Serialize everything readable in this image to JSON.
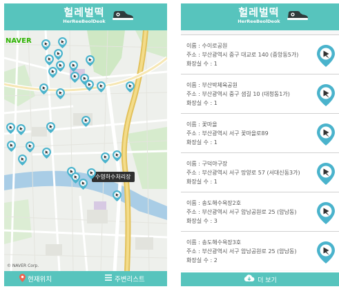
{
  "app": {
    "title": "헐레벌떡",
    "subtitle": "HerReeBeolDeok"
  },
  "map": {
    "brand": "NAVER",
    "copyright": "© NAVER Corp.",
    "tooltip": "수영하수처리장"
  },
  "bottom_bar": {
    "location_label": "현재위치",
    "list_label": "주변리스트"
  },
  "list": {
    "items": [
      {
        "name": "이름 : 수이로공원",
        "address": "주소 : 부산광역시 중구 대교로 140 (중앙동5가)",
        "toilets": "화장실 수 : 1"
      },
      {
        "name": "이름 : 부산박체육공원",
        "address": "주소 : 부산광역시 중구 샘길 10 (대청동1가)",
        "toilets": "화장실 수 : 1"
      },
      {
        "name": "이름 : 꽃마을",
        "address": "주소 : 부산광역시 서구 꽃마을로89",
        "toilets": "화장실 수 : 1"
      },
      {
        "name": "이름 : 구덕야구장",
        "address": "주소 : 부산광역시 서구 망양로 57 (서대신동3가)",
        "toilets": "화장실 수 : 1"
      },
      {
        "name": "이름 : 송도해수욕장2호",
        "address": "주소 : 부산광역시 서구 암남공원로 25 (암남동)",
        "toilets": "화장실 수 : 3"
      },
      {
        "name": "이름 : 송도해수욕장3호",
        "address": "주소 : 부산광역시 서구 암남공원로 25 (암남동)",
        "toilets": "화장실 수 : 2"
      }
    ],
    "more_label": "더 보기"
  },
  "icons": {
    "logo": "sneaker-icon",
    "marker": "map-marker-icon",
    "location": "location-pin-icon",
    "list": "menu-list-icon",
    "more": "cloud-download-icon"
  },
  "colors": {
    "accent": "#57c4bd",
    "marker": "#4ab3cc",
    "marker_text": "#333333"
  }
}
